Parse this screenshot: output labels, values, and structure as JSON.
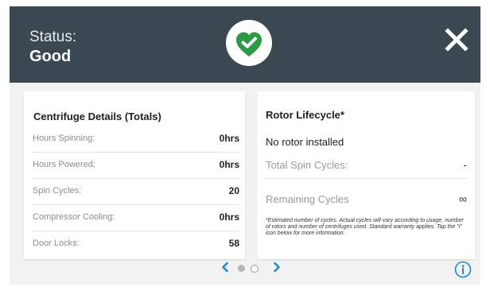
{
  "header": {
    "status_label": "Status:",
    "status_value": "Good",
    "status_icon": "heart-check-icon",
    "close_icon": "close-icon",
    "bg_color": "#3b4852",
    "status_color": "#2b9a47"
  },
  "centrifuge_details": {
    "title": "Centrifuge Details (Totals)",
    "rows": [
      {
        "label": "Hours Spinning:",
        "value": "0hrs"
      },
      {
        "label": "Hours Powered:",
        "value": "0hrs"
      },
      {
        "label": "Spin Cycles:",
        "value": "20"
      },
      {
        "label": "Compressor Cooling:",
        "value": "0hrs"
      },
      {
        "label": "Door Locks:",
        "value": "58"
      }
    ]
  },
  "rotor_lifecycle": {
    "title": "Rotor Lifecycle*",
    "status": "No rotor installed",
    "rows": [
      {
        "label": "Total Spin Cycles:",
        "value": "-"
      },
      {
        "label": "Remaining Cycles",
        "value": "∞"
      }
    ],
    "footnote": "*Estimated number of cycles. Actual cycles will vary according to usage, number of rotors and number of centrifuges used. Standard warranty applies. Tap the \"i\" icon below for more information."
  },
  "pager": {
    "prev_icon": "chevron-left-icon",
    "next_icon": "chevron-right-icon",
    "page_count": 2,
    "current_page": 1,
    "accent_color": "#1e88d2"
  },
  "info_icon": "info-icon"
}
